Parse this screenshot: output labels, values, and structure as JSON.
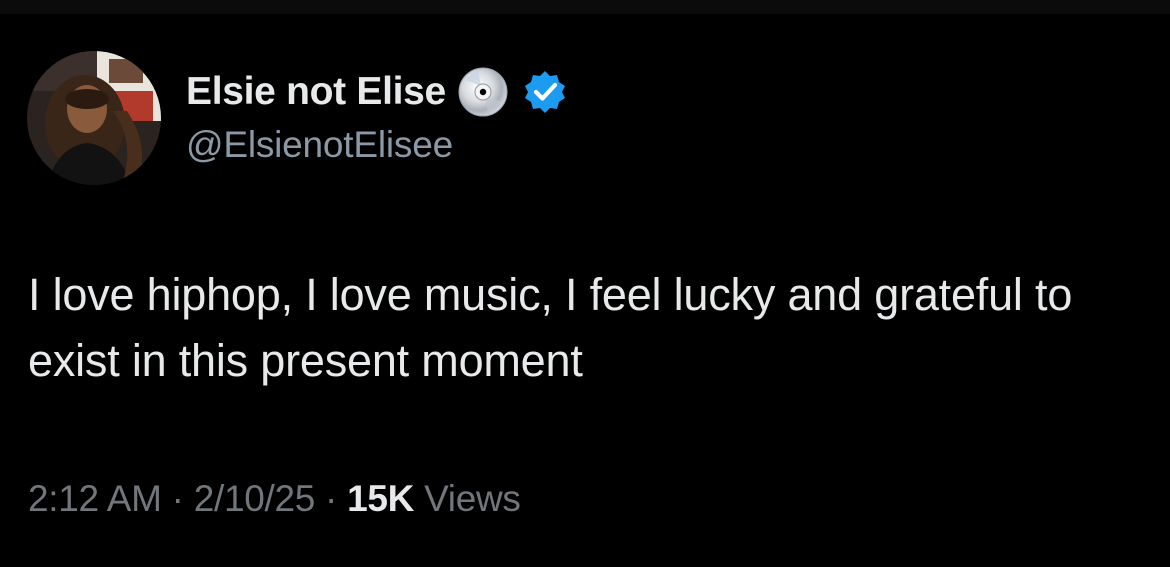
{
  "tweet": {
    "author": {
      "display_name": "Elsie not Elise",
      "handle": "@ElsienotElisee",
      "name_emoji": "optical-disc-icon",
      "verified_badge": "verified-badge-icon",
      "verified_color": "#1d9bf0"
    },
    "text": "I love hiphop, I love music, I feel lucky and grateful to exist in this present moment",
    "time": "2:12 AM",
    "date": "2/10/25",
    "separator": "·",
    "views_count": "15K",
    "views_label": "Views"
  },
  "colors": {
    "background": "#000000",
    "primary_text": "#e7e9ea",
    "secondary_text": "#71767b",
    "handle_text": "#8b98a5"
  }
}
